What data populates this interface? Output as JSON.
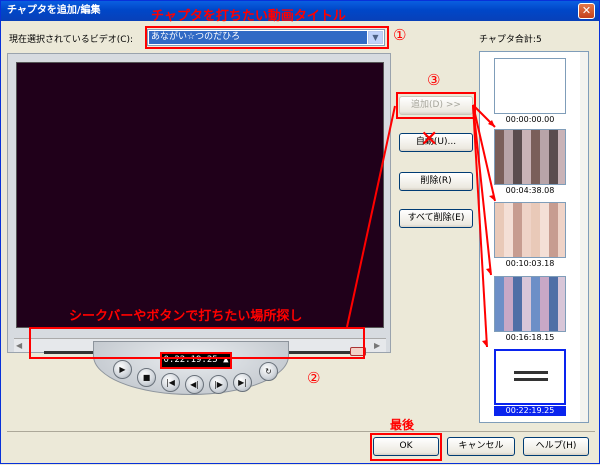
{
  "window": {
    "title": "チャプタを追加/編集",
    "close_icon": "close-icon"
  },
  "video_select": {
    "label": "現在選択されているビデオ(C):",
    "value": "あながい☆つのだひろ"
  },
  "chapter_total": "チャプタ合計:5",
  "timecode": "0:22:19:25 ▲",
  "side_buttons": {
    "add": "追加(D) >>",
    "auto": "自動(U)...",
    "delete": "削除(R)",
    "delete_all": "すべて削除(E)"
  },
  "chapters": [
    {
      "time": "00:00:00.00"
    },
    {
      "time": "00:04:38.08"
    },
    {
      "time": "00:10:03.18"
    },
    {
      "time": "00:16:18.15"
    },
    {
      "time": "00:22:19.25",
      "selected": true
    }
  ],
  "bottom_buttons": {
    "ok": "OK",
    "cancel": "キャンセル",
    "help": "ヘルプ(H)"
  },
  "annotations": {
    "title_note": "チャプタを打ちたい動画タイトル",
    "seek_note": "シークバーやボタンで打ちたい場所探し",
    "last_note": "最後",
    "marker1": "①",
    "marker2": "②",
    "marker3": "③"
  },
  "colors": {
    "annotation_red": "#ff0000",
    "selection_blue": "#0a24ee",
    "title_bar": "#0047c8"
  }
}
